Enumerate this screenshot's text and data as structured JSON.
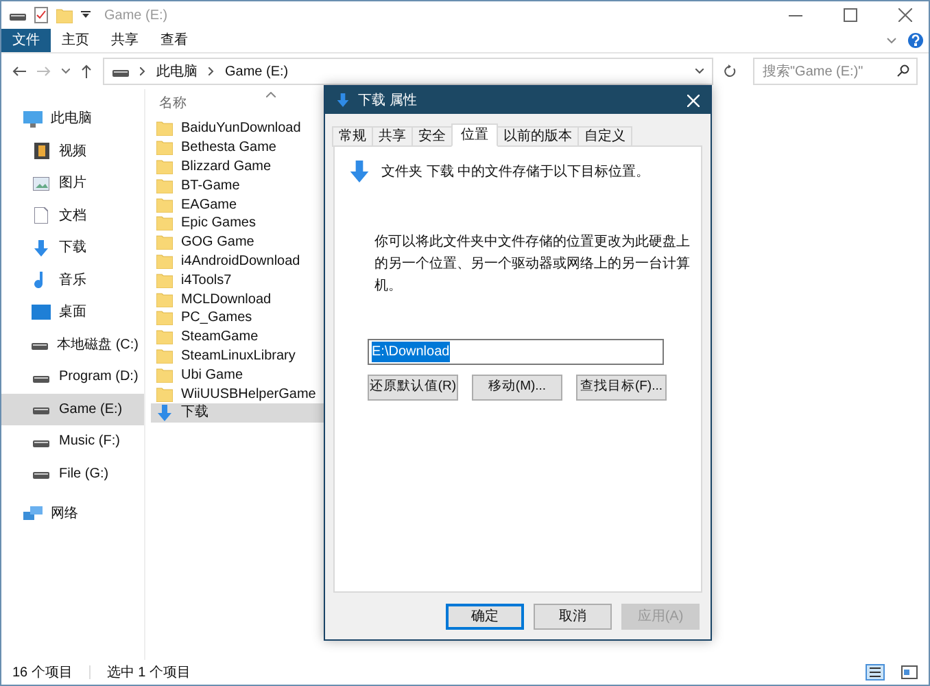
{
  "window": {
    "title": "Game (E:)"
  },
  "ribbon_tabs": [
    {
      "label": "文件",
      "selected": true
    },
    {
      "label": "主页",
      "selected": false
    },
    {
      "label": "共享",
      "selected": false
    },
    {
      "label": "查看",
      "selected": false
    }
  ],
  "address": {
    "path": [
      "此电脑",
      "Game (E:)"
    ]
  },
  "search": {
    "placeholder": "搜索\"Game (E:)\""
  },
  "sidebar": {
    "items": [
      {
        "label": "此电脑",
        "kind": "pc",
        "selected": false,
        "children": [
          {
            "label": "视频",
            "kind": "video",
            "selected": false
          },
          {
            "label": "图片",
            "kind": "pictures",
            "selected": false
          },
          {
            "label": "文档",
            "kind": "docs",
            "selected": false
          },
          {
            "label": "下载",
            "kind": "download",
            "selected": false
          },
          {
            "label": "音乐",
            "kind": "music",
            "selected": false
          },
          {
            "label": "桌面",
            "kind": "desktop",
            "selected": false
          },
          {
            "label": "本地磁盘 (C:)",
            "kind": "drive",
            "selected": false
          },
          {
            "label": "Program (D:)",
            "kind": "drive",
            "selected": false
          },
          {
            "label": "Game (E:)",
            "kind": "drive",
            "selected": true
          },
          {
            "label": "Music (F:)",
            "kind": "drive",
            "selected": false
          },
          {
            "label": "File (G:)",
            "kind": "drive",
            "selected": false
          }
        ]
      },
      {
        "label": "网络",
        "kind": "network",
        "selected": false
      }
    ]
  },
  "file_list": {
    "column": "名称",
    "items": [
      {
        "name": "BaiduYunDownload",
        "kind": "folder",
        "selected": false
      },
      {
        "name": "Bethesta Game",
        "kind": "folder",
        "selected": false
      },
      {
        "name": "Blizzard Game",
        "kind": "folder",
        "selected": false
      },
      {
        "name": "BT-Game",
        "kind": "folder",
        "selected": false
      },
      {
        "name": "EAGame",
        "kind": "folder",
        "selected": false
      },
      {
        "name": "Epic Games",
        "kind": "folder",
        "selected": false
      },
      {
        "name": "GOG Game",
        "kind": "folder",
        "selected": false
      },
      {
        "name": "i4AndroidDownload",
        "kind": "folder",
        "selected": false
      },
      {
        "name": "i4Tools7",
        "kind": "folder",
        "selected": false
      },
      {
        "name": "MCLDownload",
        "kind": "folder",
        "selected": false
      },
      {
        "name": "PC_Games",
        "kind": "folder",
        "selected": false
      },
      {
        "name": "SteamGame",
        "kind": "folder",
        "selected": false
      },
      {
        "name": "SteamLinuxLibrary",
        "kind": "folder",
        "selected": false
      },
      {
        "name": "Ubi Game",
        "kind": "folder",
        "selected": false
      },
      {
        "name": "WiiUUSBHelperGame",
        "kind": "folder",
        "selected": false
      },
      {
        "name": "下载",
        "kind": "download",
        "selected": true
      }
    ]
  },
  "status_bar": {
    "count": "16 个项目",
    "selection": "选中 1 个项目"
  },
  "dialog": {
    "title": "下载 属性",
    "tabs": [
      {
        "label": "常规",
        "selected": false
      },
      {
        "label": "共享",
        "selected": false
      },
      {
        "label": "安全",
        "selected": false
      },
      {
        "label": "位置",
        "selected": true
      },
      {
        "label": "以前的版本",
        "selected": false
      },
      {
        "label": "自定义",
        "selected": false
      }
    ],
    "intro": "文件夹 下载 中的文件存储于以下目标位置。",
    "description": "你可以将此文件夹中文件存储的位置更改为此硬盘上的另一个位置、另一个驱动器或网络上的另一台计算机。",
    "path_value": "E:\\Download",
    "actions": [
      {
        "label": "还原默认值(R)",
        "disabled": false
      },
      {
        "label": "移动(M)...",
        "disabled": false
      },
      {
        "label": "查找目标(F)...",
        "disabled": false
      }
    ],
    "buttons": [
      {
        "label": "确定",
        "disabled": false,
        "default": true
      },
      {
        "label": "取消",
        "disabled": false,
        "default": false
      },
      {
        "label": "应用(A)",
        "disabled": true,
        "default": false
      }
    ]
  }
}
